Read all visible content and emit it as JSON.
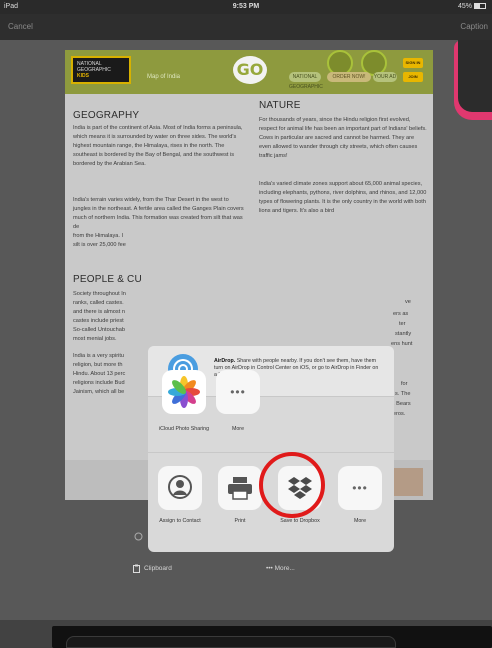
{
  "status": {
    "carrier": "iPad",
    "time": "9:53 PM",
    "battery": "45%"
  },
  "nav": {
    "cancel": "Cancel",
    "caption": "Caption"
  },
  "doc": {
    "banner": {
      "logo_line1": "NATIONAL",
      "logo_line2": "GEOGRAPHIC",
      "logo_line3": "KIDS",
      "map_label": "Map of India",
      "go": "GO",
      "pill_ng": "NATIONAL GEOGRAPHIC",
      "pill_order": "ORDER NOW!",
      "pill_yo": "YOUR AD",
      "signin": "SIGN IN",
      "join": "JOIN"
    },
    "geo_title": "GEOGRAPHY",
    "geo_text": "India is part of the continent of Asia. Most of India forms a peninsula, which means it is surrounded by water on three sides. The world's highest mountain range, the Himalaya, rises in the north. The southeast is bordered by the Bay of Bengal, and the southwest is bordered by the Arabian Sea.",
    "geo_text2": "India's terrain varies widely, from the Thar Desert in the west to jungles in the northeast. A fertile area called the Ganges Plain covers much of northern India. This formation was created from silt that was de",
    "geo_frag1": "from the Himalaya. I",
    "geo_frag2": "silt is over 25,000 fee",
    "nature_title": "NATURE",
    "nature_text": "For thousands of years, since the Hindu religion first evolved, respect for animal life has been an important part of Indians' beliefs. Cows in particular are sacred and cannot be harmed. They are even allowed to wander through city streets, which often causes traffic jams!",
    "nature_text2": "India's varied climate zones support about 65,000 animal species, including elephants, pythons, river dolphins, and rhinos, and 12,000 types of flowering plants. It is the only country in the world with both lions and tigers. It's also a bird",
    "people_title": "PEOPLE & CU",
    "people_frag1": "Society throughout In",
    "people_frag2": "ranks, called castes.",
    "people_frag3": "and there is almost n",
    "people_frag4": "castes include priest",
    "people_frag5": "So-called Untouchab",
    "people_frag6": "most menial jobs.",
    "people_frag7": "India is a very spiritu",
    "people_frag8": "religion, but more th",
    "people_frag9": "Hindu. About 13 perc",
    "people_frag10": "religions include Bud",
    "people_frag11": "Jainism, which all be",
    "right_frag1": "ve",
    "right_frag2": "ers as",
    "right_frag3": "ter",
    "right_frag4": "stantly",
    "right_frag5": "ens hunt",
    "right_frag6": "for",
    "right_frag7": "s. The",
    "right_frag8": ". Bears",
    "right_frag9": "oceros."
  },
  "share": {
    "airdrop_title": "AirDrop.",
    "airdrop_body": "Share with people nearby. If you don't see them, have them turn on AirDrop in Control Center on iOS, or go to AirDrop in Finder on a Mac.",
    "row1": [
      {
        "label": "iCloud Photo Sharing"
      },
      {
        "label": "More"
      }
    ],
    "row2": [
      {
        "label": "Assign to Contact"
      },
      {
        "label": "Print"
      },
      {
        "label": "Save to Dropbox"
      },
      {
        "label": "More"
      }
    ]
  },
  "bottom": {
    "clipboard": "Clipboard",
    "more": "More..."
  },
  "colors": {
    "highlight": "#e01a1a",
    "airdrop": "#4a9de0",
    "dropbox": "#4a4a4a"
  }
}
